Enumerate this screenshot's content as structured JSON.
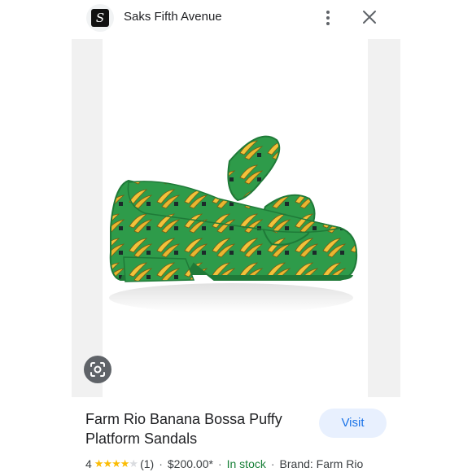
{
  "header": {
    "site_name": "Saks Fifth Avenue",
    "logo_icon": "saks-logo-icon",
    "more_icon": "more-vert-icon",
    "close_icon": "close-icon"
  },
  "image": {
    "lens_icon": "google-lens-icon"
  },
  "product": {
    "title": "Farm Rio Banana Bossa Puffy Platform Sandals",
    "visit_label": "Visit",
    "rating_value": "4",
    "rating_stars": 4,
    "rating_max": 5,
    "review_count": "(1)",
    "price": "$200.00*",
    "stock": "In stock",
    "brand": "Brand: Farm Rio",
    "separator": "·"
  },
  "colors": {
    "accent": "#1a73e8",
    "stock_green": "#188038",
    "star": "#fbbc04",
    "sandal_green": "#2e9b4a",
    "banana_yellow": "#f2c23a"
  }
}
